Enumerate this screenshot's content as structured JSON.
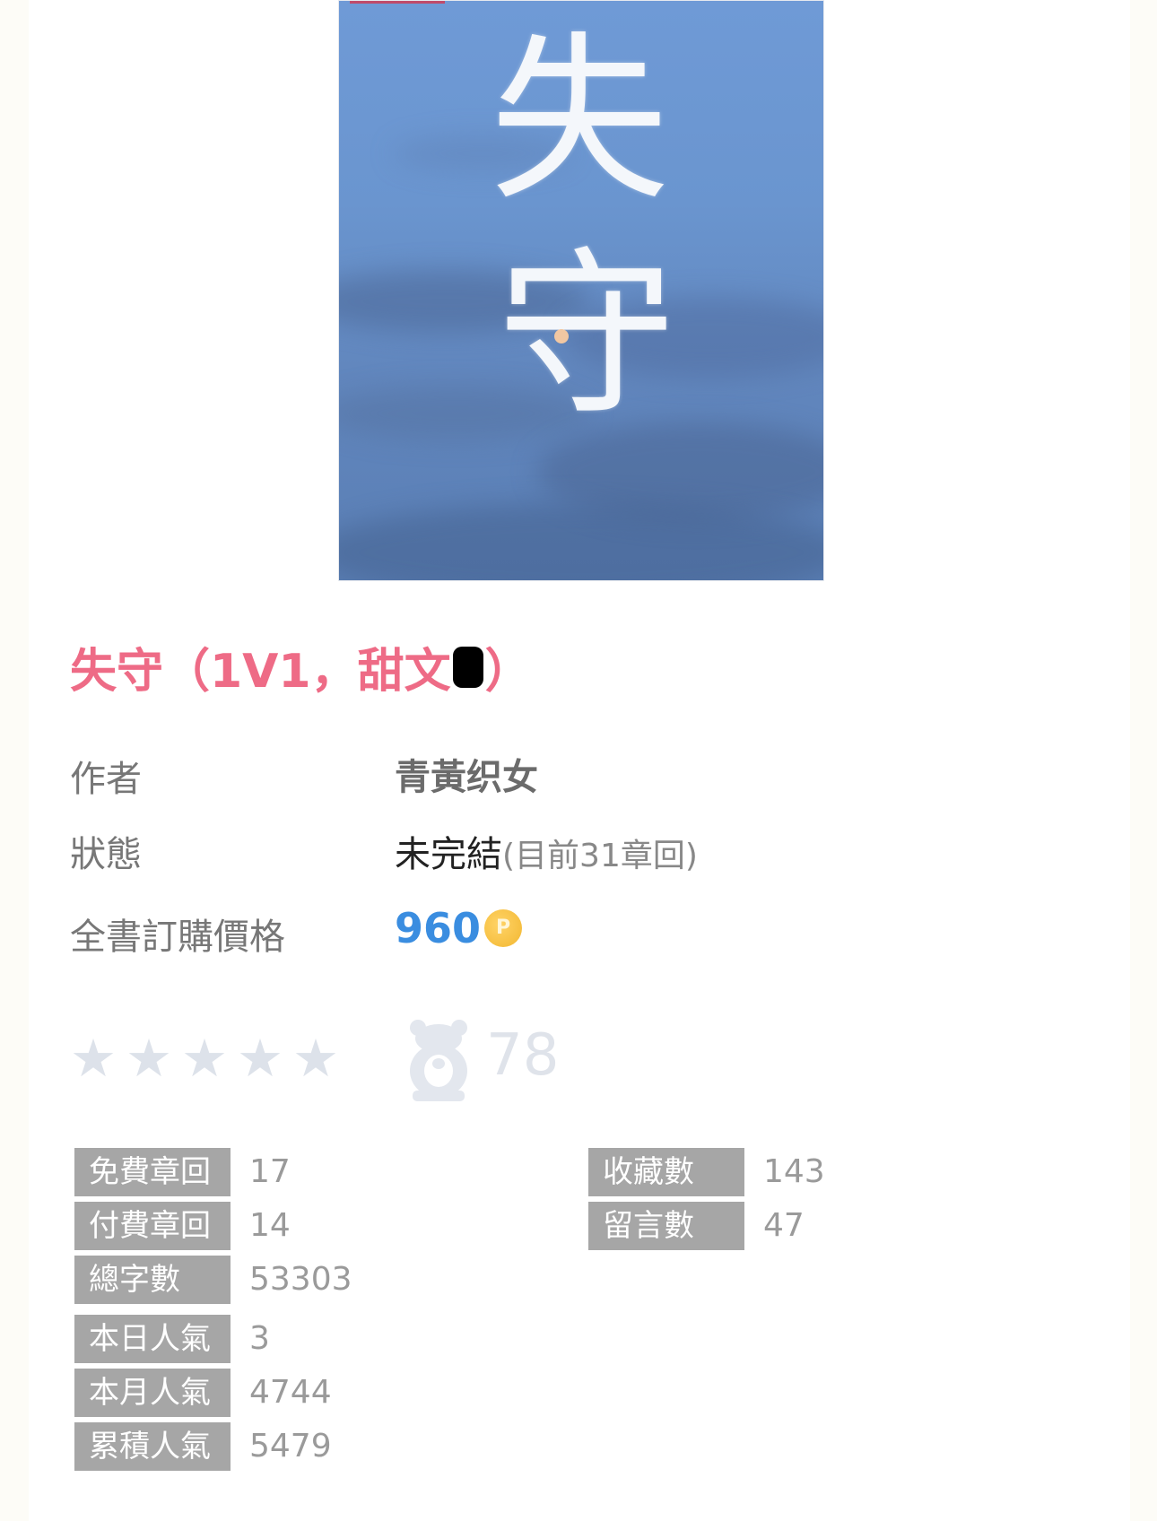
{
  "cover": {
    "chars": [
      "失",
      "守"
    ]
  },
  "book": {
    "title_main": "失守（1V1，甜文",
    "title_end": "）"
  },
  "info": {
    "author_label": "作者",
    "author_value": "青黃织女",
    "status_label": "狀態",
    "status_value": "未完結",
    "status_sub": "(目前31章回)",
    "price_label": "全書訂購價格",
    "price_value": "960",
    "coin_icon_text": "P"
  },
  "rating": {
    "stars_filled": 0,
    "stars_total": 5,
    "score": "78"
  },
  "stats": {
    "free_chapters_label": "免費章回",
    "free_chapters": "17",
    "paid_chapters_label": "付費章回",
    "paid_chapters": "14",
    "total_words_label": "總字數",
    "total_words": "53303",
    "today_popularity_label": "本日人氣",
    "today_popularity": "3",
    "month_popularity_label": "本月人氣",
    "month_popularity": "4744",
    "total_popularity_label": "累積人氣",
    "total_popularity": "5479",
    "favorites_label": "收藏數",
    "favorites": "143",
    "comments_label": "留言數",
    "comments": "47"
  },
  "colors": {
    "title": "#ee6b86",
    "price": "#3a8de0",
    "stat_label_bg": "#a6a6a6"
  }
}
